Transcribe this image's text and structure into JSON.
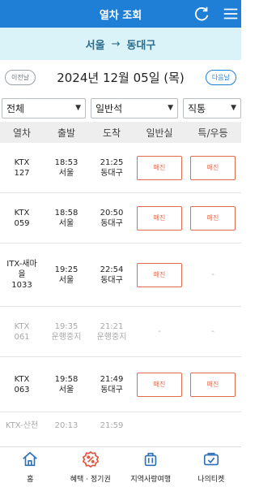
{
  "header": {
    "title": "열차 조회",
    "refresh_icon": "refresh-icon",
    "menu_icon": "menu-icon"
  },
  "route": {
    "from": "서울",
    "arrow": "→",
    "to": "동대구"
  },
  "datebar": {
    "prev_label": "이전날",
    "date": "2024년 12월 05일 (목)",
    "next_label": "다음날"
  },
  "filters": {
    "type": "전체",
    "seat": "일반석",
    "route": "직통"
  },
  "table": {
    "headers": [
      "열차",
      "출발",
      "도착",
      "일반실",
      "특/우등"
    ],
    "rows": [
      {
        "train": "KTX\n127",
        "dep_time": "18:53",
        "dep_station": "서울",
        "arr_time": "21:25",
        "arr_station": "동대구",
        "general": "매진",
        "special": "매진",
        "disabled": false
      },
      {
        "train": "KTX\n059",
        "dep_time": "18:58",
        "dep_station": "서울",
        "arr_time": "20:50",
        "arr_station": "동대구",
        "general": "매진",
        "special": "매진",
        "disabled": false
      },
      {
        "train": "ITX-새마\n을\n1033",
        "dep_time": "19:25",
        "dep_station": "서울",
        "arr_time": "22:54",
        "arr_station": "동대구",
        "general": "매진",
        "special": "-",
        "disabled": false
      },
      {
        "train": "KTX\n061",
        "dep_time": "19:35",
        "dep_station": "운행중지",
        "arr_time": "21:21",
        "arr_station": "운행중지",
        "general": "-",
        "special": "-",
        "disabled": true
      },
      {
        "train": "KTX\n063",
        "dep_time": "19:58",
        "dep_station": "서울",
        "arr_time": "21:49",
        "arr_station": "동대구",
        "general": "매진",
        "special": "매진",
        "disabled": false
      },
      {
        "train": "KTX-산천",
        "dep_time": "20:13",
        "dep_station": "",
        "arr_time": "21:59",
        "arr_station": "",
        "general": "",
        "special": "",
        "disabled": true
      }
    ]
  },
  "tabbar": {
    "items": [
      {
        "label": "홈",
        "icon": "home-icon"
      },
      {
        "label": "혜택 · 정기권",
        "icon": "discount-icon"
      },
      {
        "label": "지역사랑여행",
        "icon": "luggage-icon"
      },
      {
        "label": "나의티켓",
        "icon": "ticket-icon"
      }
    ]
  }
}
